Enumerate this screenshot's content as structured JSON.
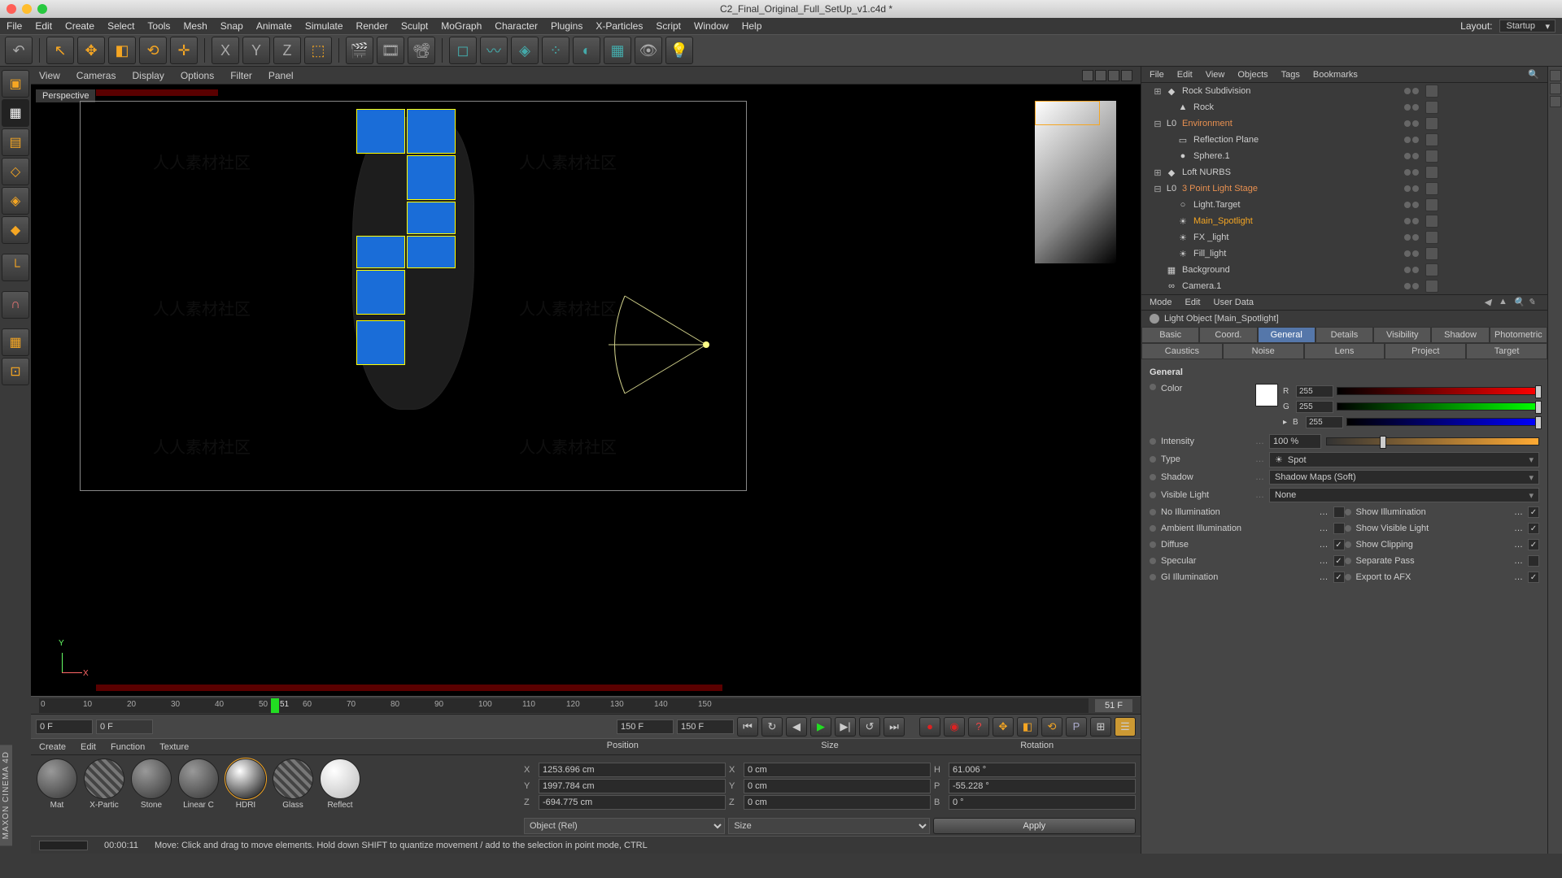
{
  "window": {
    "title": "C2_Final_Original_Full_SetUp_v1.c4d *"
  },
  "menu": {
    "items": [
      "File",
      "Edit",
      "Create",
      "Select",
      "Tools",
      "Mesh",
      "Snap",
      "Animate",
      "Simulate",
      "Render",
      "Sculpt",
      "MoGraph",
      "Character",
      "Plugins",
      "X-Particles",
      "Script",
      "Window",
      "Help"
    ],
    "layout_label": "Layout:",
    "layout_value": "Startup"
  },
  "viewmenu": {
    "items": [
      "View",
      "Cameras",
      "Display",
      "Options",
      "Filter",
      "Panel"
    ]
  },
  "viewport": {
    "label": "Perspective",
    "axis_y": "Y",
    "axis_x": "X"
  },
  "timeline": {
    "ticks": [
      "0",
      "10",
      "20",
      "30",
      "40",
      "50",
      "51",
      "60",
      "70",
      "80",
      "90",
      "100",
      "110",
      "120",
      "130",
      "140",
      "150"
    ],
    "frame_display": "51 F",
    "start": "0 F",
    "cur": "0 F",
    "end1": "150 F",
    "end2": "150 F"
  },
  "materials": {
    "menu": [
      "Create",
      "Edit",
      "Function",
      "Texture"
    ],
    "items": [
      {
        "name": "Mat",
        "cls": ""
      },
      {
        "name": "X-Partic",
        "cls": "stripe"
      },
      {
        "name": "Stone",
        "cls": ""
      },
      {
        "name": "Linear C",
        "cls": ""
      },
      {
        "name": "HDRI",
        "cls": "glass"
      },
      {
        "name": "Glass",
        "cls": "stripe"
      },
      {
        "name": "Reflect",
        "cls": "white"
      }
    ]
  },
  "coords": {
    "headers": [
      "Position",
      "Size",
      "Rotation"
    ],
    "rows": [
      {
        "axis": "X",
        "p": "1253.696 cm",
        "s": "0 cm",
        "rl": "H",
        "r": "61.006 °"
      },
      {
        "axis": "Y",
        "p": "1997.784 cm",
        "s": "0 cm",
        "rl": "P",
        "r": "-55.228 °"
      },
      {
        "axis": "Z",
        "p": "-694.775 cm",
        "s": "0 cm",
        "rl": "B",
        "r": "0 °"
      }
    ],
    "obj_mode": "Object (Rel)",
    "size_mode": "Size",
    "apply": "Apply"
  },
  "status": {
    "time": "00:00:11",
    "hint": "Move: Click and drag to move elements. Hold down SHIFT to quantize movement / add to the selection in point mode, CTRL"
  },
  "objmenu": {
    "items": [
      "File",
      "Edit",
      "View",
      "Objects",
      "Tags",
      "Bookmarks"
    ]
  },
  "objects": [
    {
      "ind": 1,
      "exp": "⊞",
      "name": "Rock Subdivision",
      "icon": "◆",
      "cls": ""
    },
    {
      "ind": 2,
      "exp": "",
      "name": "Rock",
      "icon": "▲",
      "cls": ""
    },
    {
      "ind": 1,
      "exp": "⊟",
      "name": "Environment",
      "icon": "L0",
      "cls": "env"
    },
    {
      "ind": 2,
      "exp": "",
      "name": "Reflection Plane",
      "icon": "▭",
      "cls": ""
    },
    {
      "ind": 2,
      "exp": "",
      "name": "Sphere.1",
      "icon": "●",
      "cls": ""
    },
    {
      "ind": 1,
      "exp": "⊞",
      "name": "Loft NURBS",
      "icon": "◆",
      "cls": ""
    },
    {
      "ind": 1,
      "exp": "⊟",
      "name": "3 Point Light Stage",
      "icon": "L0",
      "cls": "env"
    },
    {
      "ind": 2,
      "exp": "",
      "name": "Light.Target",
      "icon": "○",
      "cls": ""
    },
    {
      "ind": 2,
      "exp": "",
      "name": "Main_Spotlight",
      "icon": "☀",
      "cls": "sel"
    },
    {
      "ind": 2,
      "exp": "",
      "name": "FX _light",
      "icon": "☀",
      "cls": ""
    },
    {
      "ind": 2,
      "exp": "",
      "name": "Fill_light",
      "icon": "☀",
      "cls": ""
    },
    {
      "ind": 1,
      "exp": "",
      "name": "Background",
      "icon": "▦",
      "cls": ""
    },
    {
      "ind": 1,
      "exp": "",
      "name": "Camera.1",
      "icon": "∞",
      "cls": ""
    }
  ],
  "attrmenu": {
    "items": [
      "Mode",
      "Edit",
      "User Data"
    ]
  },
  "attr": {
    "title": "Light Object [Main_Spotlight]",
    "tabs": [
      "Basic",
      "Coord.",
      "General",
      "Details",
      "Visibility",
      "Shadow",
      "Photometric",
      "Caustics",
      "Noise",
      "Lens",
      "Project",
      "Target"
    ],
    "active_tab": 2,
    "section": "General",
    "color_label": "Color",
    "rgb": {
      "r_label": "R",
      "r": "255",
      "g_label": "G",
      "g": "255",
      "b_label": "B",
      "b": "255"
    },
    "intensity_label": "Intensity",
    "intensity": "100 %",
    "type_label": "Type",
    "type": "Spot",
    "shadow_label": "Shadow",
    "shadow": "Shadow Maps (Soft)",
    "vlight_label": "Visible Light",
    "vlight": "None",
    "checks": [
      {
        "l": "No Illumination",
        "v": false
      },
      {
        "l": "Show Illumination",
        "v": true
      },
      {
        "l": "Ambient Illumination",
        "v": false
      },
      {
        "l": "Show Visible Light",
        "v": true
      },
      {
        "l": "Diffuse",
        "v": true
      },
      {
        "l": "Show Clipping",
        "v": true
      },
      {
        "l": "Specular",
        "v": true
      },
      {
        "l": "Separate Pass",
        "v": false
      },
      {
        "l": "GI Illumination",
        "v": true
      },
      {
        "l": "Export to AFX",
        "v": true
      }
    ]
  },
  "sidebadge": "MAXON CINEMA 4D"
}
